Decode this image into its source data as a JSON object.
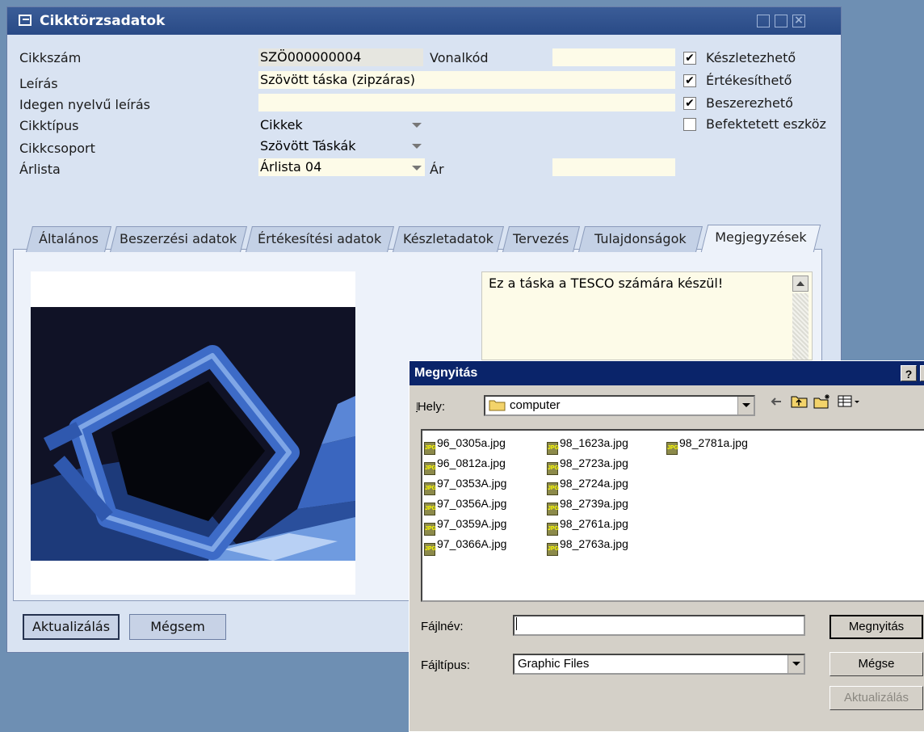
{
  "main_window": {
    "title": "Cikktörzsadatok",
    "fields": {
      "cikkszam_label": "Cikkszám",
      "cikkszam_value": "SZÖ000000004",
      "vonalkod_label": "Vonalkód",
      "vonalkod_value": "",
      "leiras_label": "Leírás",
      "leiras_value": "Szövött táska (zipzáras)",
      "idegen_label": "Idegen nyelvű leírás",
      "idegen_value": "",
      "cikktipus_label": "Cikktípus",
      "cikktipus_value": "Cikkek",
      "cikkcsoport_label": "Cikkcsoport",
      "cikkcsoport_value": "Szövött Táskák",
      "arlista_label": "Árlista",
      "arlista_value": "Árlista 04",
      "ar_label": "Ár",
      "ar_value": ""
    },
    "checkboxes": [
      {
        "label": "Készletezhető",
        "checked": true
      },
      {
        "label": "Értékesíthető",
        "checked": true
      },
      {
        "label": "Beszerezhető",
        "checked": true
      },
      {
        "label": "Befektetett eszköz",
        "checked": false
      }
    ],
    "tabs": [
      {
        "label": "Általános",
        "active": false
      },
      {
        "label": "Beszerzési adatok",
        "active": false
      },
      {
        "label": "Értékesítési adatok",
        "active": false
      },
      {
        "label": "Készletadatok",
        "active": false
      },
      {
        "label": "Tervezés",
        "active": false
      },
      {
        "label": "Tulajdonságok",
        "active": false
      },
      {
        "label": "Megjegyzések",
        "active": true
      }
    ],
    "memo_text": "Ez a táska a TESCO számára készül!",
    "buttons": {
      "update": "Aktualizálás",
      "cancel": "Mégsem"
    },
    "check_mark": "✔"
  },
  "open_dialog": {
    "title": "Megnyitás",
    "help_label": "?",
    "location_label": "Hely:",
    "location_value": "computer",
    "files": [
      "96_0305a.jpg",
      "96_0812a.jpg",
      "97_0353A.jpg",
      "97_0356A.jpg",
      "97_0359A.jpg",
      "97_0366A.jpg",
      "98_1623a.jpg",
      "98_2723a.jpg",
      "98_2724a.jpg",
      "98_2739a.jpg",
      "98_2761a.jpg",
      "98_2763a.jpg",
      "98_2781a.jpg"
    ],
    "file_icon_text": "JPG",
    "filename_label": "Fájlnév:",
    "filename_value": "",
    "filetype_label": "Fájltípus:",
    "filetype_value": "Graphic Files",
    "buttons": {
      "open": "Megnyitás",
      "cancel": "Mégse",
      "update": "Aktualizálás"
    },
    "toolbar_icons": [
      "back-arrow-icon",
      "up-folder-icon",
      "new-folder-icon",
      "view-menu-icon"
    ]
  }
}
